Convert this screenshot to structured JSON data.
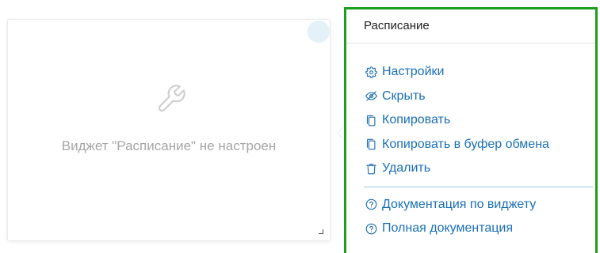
{
  "widget": {
    "message": "Виджет \"Расписание\" не настроен",
    "icon": "wrench-icon"
  },
  "menu": {
    "title": "Расписание",
    "items": [
      {
        "label": "Настройки",
        "icon": "gear-icon"
      },
      {
        "label": "Скрыть",
        "icon": "eye-off-icon"
      },
      {
        "label": "Копировать",
        "icon": "copy-icon"
      },
      {
        "label": "Копировать в буфер обмена",
        "icon": "copy-icon"
      },
      {
        "label": "Удалить",
        "icon": "trash-icon"
      }
    ],
    "doc_items": [
      {
        "label": "Документация по виджету",
        "icon": "help-circle-icon"
      },
      {
        "label": "Полная документация",
        "icon": "help-circle-icon"
      }
    ]
  },
  "colors": {
    "link": "#1a6fb5",
    "menu_border": "#1e9e1e",
    "placeholder_text": "#a6a6a6"
  }
}
